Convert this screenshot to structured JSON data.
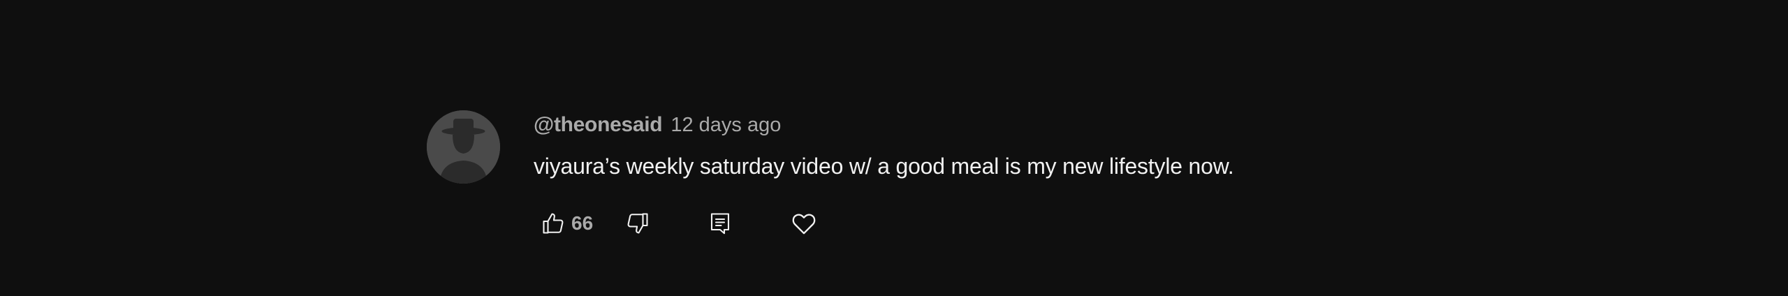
{
  "comment": {
    "author": "@theonesaid",
    "timestamp": "12 days ago",
    "text": "viyaura’s weekly saturday video w/ a good meal is my new lifestyle now.",
    "avatar_icon": "default-avatar-icon",
    "like_count": "66"
  },
  "actions": {
    "like_icon": "thumbs-up-icon",
    "dislike_icon": "thumbs-down-icon",
    "reply_icon": "reply-icon",
    "heart_icon": "heart-icon"
  },
  "colors": {
    "background": "#0f0f0f",
    "secondary_text": "#aaaaaa",
    "primary_text": "#f1f1f1",
    "avatar_bg": "#4a4a4a"
  }
}
